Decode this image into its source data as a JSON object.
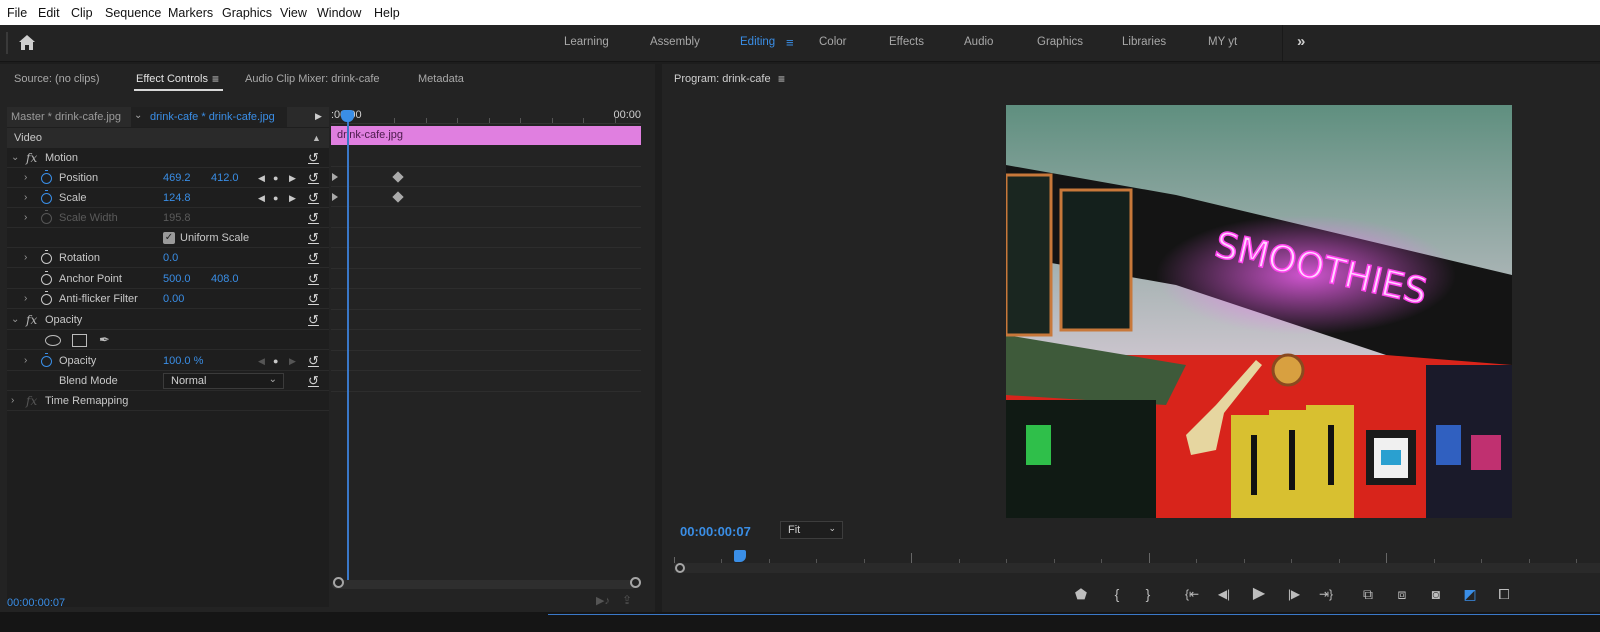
{
  "menubar": {
    "items": [
      "File",
      "Edit",
      "Clip",
      "Sequence",
      "Markers",
      "Graphics",
      "View",
      "Window",
      "Help"
    ]
  },
  "workspaces": {
    "home_icon": "home-icon",
    "tabs": [
      {
        "label": "Learning",
        "active": false
      },
      {
        "label": "Assembly",
        "active": false
      },
      {
        "label": "Editing",
        "active": true
      },
      {
        "label": "Color",
        "active": false
      },
      {
        "label": "Effects",
        "active": false
      },
      {
        "label": "Audio",
        "active": false
      },
      {
        "label": "Graphics",
        "active": false
      },
      {
        "label": "Libraries",
        "active": false
      },
      {
        "label": "MY yt",
        "active": false
      }
    ],
    "overflow_icon": "»"
  },
  "left_panel": {
    "tabs": [
      {
        "label": "Source: (no clips)",
        "active": false
      },
      {
        "label": "Effect Controls",
        "active": true
      },
      {
        "label": "Audio Clip Mixer: drink-cafe",
        "active": false
      },
      {
        "label": "Metadata",
        "active": false
      }
    ],
    "master_clip": "Master * drink-cafe.jpg",
    "sequence_clip": "drink-cafe * drink-cafe.jpg",
    "timeline_start": ":00:00",
    "timeline_end": "00:00",
    "clip_name": "drink-cafe.jpg",
    "section_video": "Video",
    "effects": {
      "motion": {
        "label": "Motion",
        "position": {
          "label": "Position",
          "x": "469.2",
          "y": "412.0"
        },
        "scale": {
          "label": "Scale",
          "value": "124.8"
        },
        "scale_width": {
          "label": "Scale Width",
          "value": "195.8"
        },
        "uniform_scale": {
          "label": "Uniform Scale",
          "checked": true
        },
        "rotation": {
          "label": "Rotation",
          "value": "0.0"
        },
        "anchor_point": {
          "label": "Anchor Point",
          "x": "500.0",
          "y": "408.0"
        },
        "anti_flicker": {
          "label": "Anti-flicker Filter",
          "value": "0.00"
        }
      },
      "opacity": {
        "label": "Opacity",
        "opacity": {
          "label": "Opacity",
          "value": "100.0 %"
        },
        "blend_mode": {
          "label": "Blend Mode",
          "value": "Normal"
        }
      },
      "time_remapping": {
        "label": "Time Remapping"
      }
    },
    "timecode": "00:00:00:07"
  },
  "program_monitor": {
    "title": "Program: drink-cafe",
    "timecode": "00:00:00:07",
    "zoom": "Fit",
    "neon_text": "SMOOTHIES",
    "transport": [
      "marker-icon",
      "mark-in-icon",
      "mark-out-icon",
      "go-to-in-icon",
      "step-back-icon",
      "play-icon",
      "step-forward-icon",
      "go-to-out-icon",
      "lift-icon",
      "extract-icon",
      "export-frame-icon",
      "comparison-view-icon",
      "multi-camera-icon"
    ],
    "accent": "#3a8ee6"
  }
}
